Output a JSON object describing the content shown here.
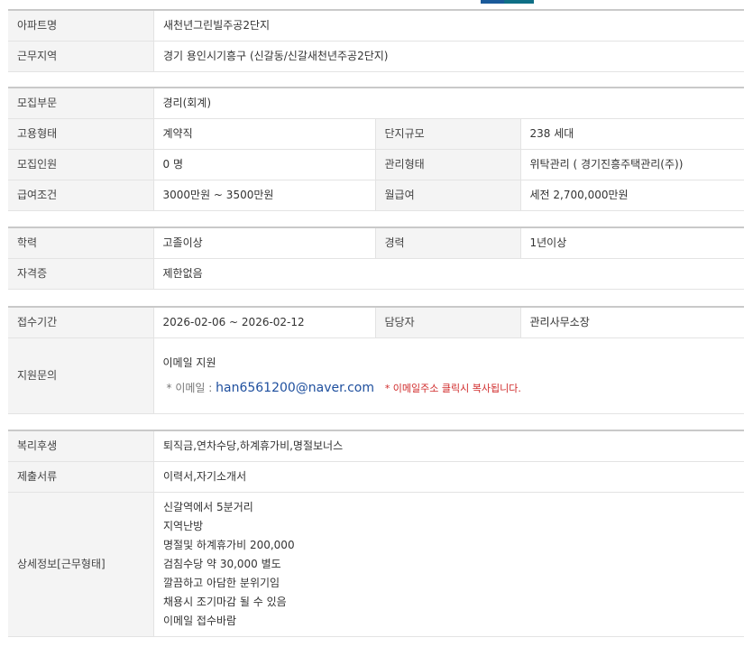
{
  "section1": {
    "rows": [
      {
        "label": "아파트명",
        "value": "새천년그린빌주공2단지"
      },
      {
        "label": "근무지역",
        "value": "경기  용인시기흥구 (신갈동/신갈새천년주공2단지)"
      }
    ]
  },
  "section2": {
    "row1": {
      "label": "모집부문",
      "value": "경리(회계)"
    },
    "row2": {
      "label": "고용형태",
      "value": "계약직",
      "label2": "단지규모",
      "value2": "238 세대"
    },
    "row3": {
      "label": "모집인원",
      "value": "0 명",
      "label2": "관리형태",
      "value2": "위탁관리 ( 경기진흥주택관리(주))"
    },
    "row4": {
      "label": "급여조건",
      "value": "3000만원 ~ 3500만원",
      "label2": "월급여",
      "value2": "세전 2,700,000만원"
    }
  },
  "section3": {
    "row1": {
      "label": "학력",
      "value": "고졸이상",
      "label2": "경력",
      "value2": "1년이상"
    },
    "row2": {
      "label": "자격증",
      "value": "제한없음"
    }
  },
  "section4": {
    "row1": {
      "label": "접수기간",
      "value": "2026-02-06 ~ 2026-02-12",
      "label2": "담당자",
      "value2": "관리사무소장"
    },
    "row2": {
      "label": "지원문의",
      "value": "이메일 지원",
      "email_label": "* 이메일    :",
      "email": "han6561200@naver.com",
      "email_note": "* 이메일주소 클릭시 복사됩니다."
    }
  },
  "section5": {
    "row1": {
      "label": "복리후생",
      "value": "퇴직금,연차수당,하계휴가비,명절보너스"
    },
    "row2": {
      "label": "제출서류",
      "value": "이력서,자기소개서"
    },
    "row3": {
      "label": "상세정보[근무형태]",
      "lines": [
        "신갈역에서 5분거리",
        "지역난방",
        "명절및 하계휴가비 200,000",
        "검침수당 약 30,000 별도",
        "깔끔하고 아담한 분위기임",
        "채용시 조기마감 될 수 있음",
        "이메일 접수바람"
      ]
    }
  },
  "colors": {
    "accent": "#0f6f86",
    "header_bg": "#f4f4f4",
    "email": "#1e4f9e",
    "note": "#d02a2a"
  }
}
